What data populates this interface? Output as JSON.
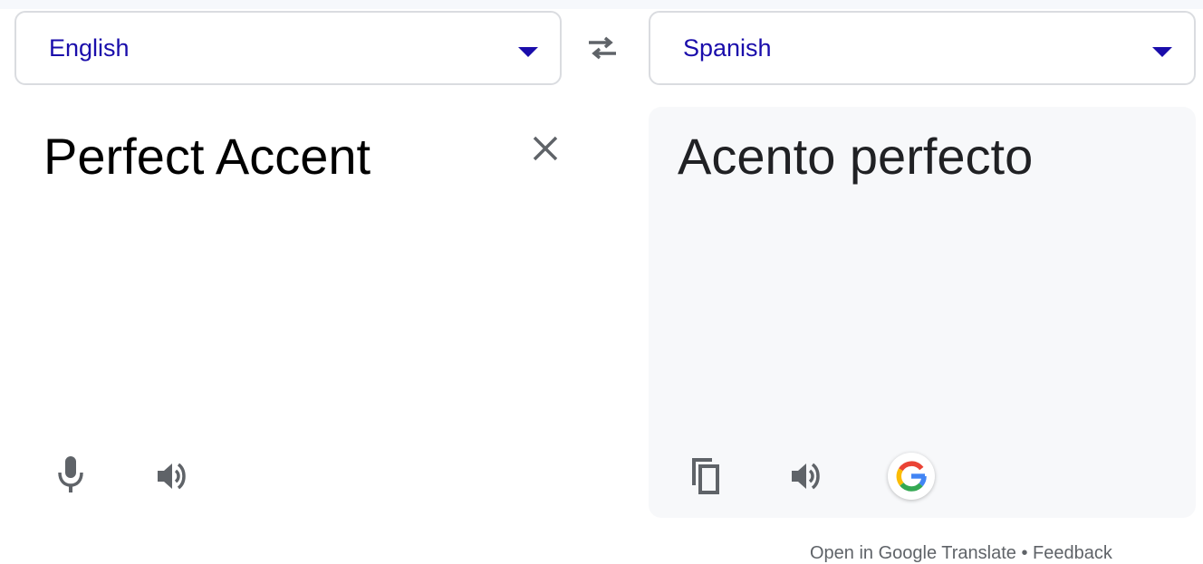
{
  "source": {
    "language": "English",
    "text": "Perfect Accent"
  },
  "target": {
    "language": "Spanish",
    "text": "Acento perfecto"
  },
  "icons": {
    "dropdown": "chevron-down-icon",
    "swap": "swap-arrows-icon",
    "clear": "close-icon",
    "mic": "microphone-icon",
    "listen": "speaker-icon",
    "copy": "copy-icon",
    "google": "google-g-icon"
  },
  "colors": {
    "language_label": "#1a0dab",
    "icon_gray": "#5f6368",
    "target_background": "#f7f8fa"
  },
  "footer": {
    "text": "Open in Google Translate • Feedback"
  }
}
